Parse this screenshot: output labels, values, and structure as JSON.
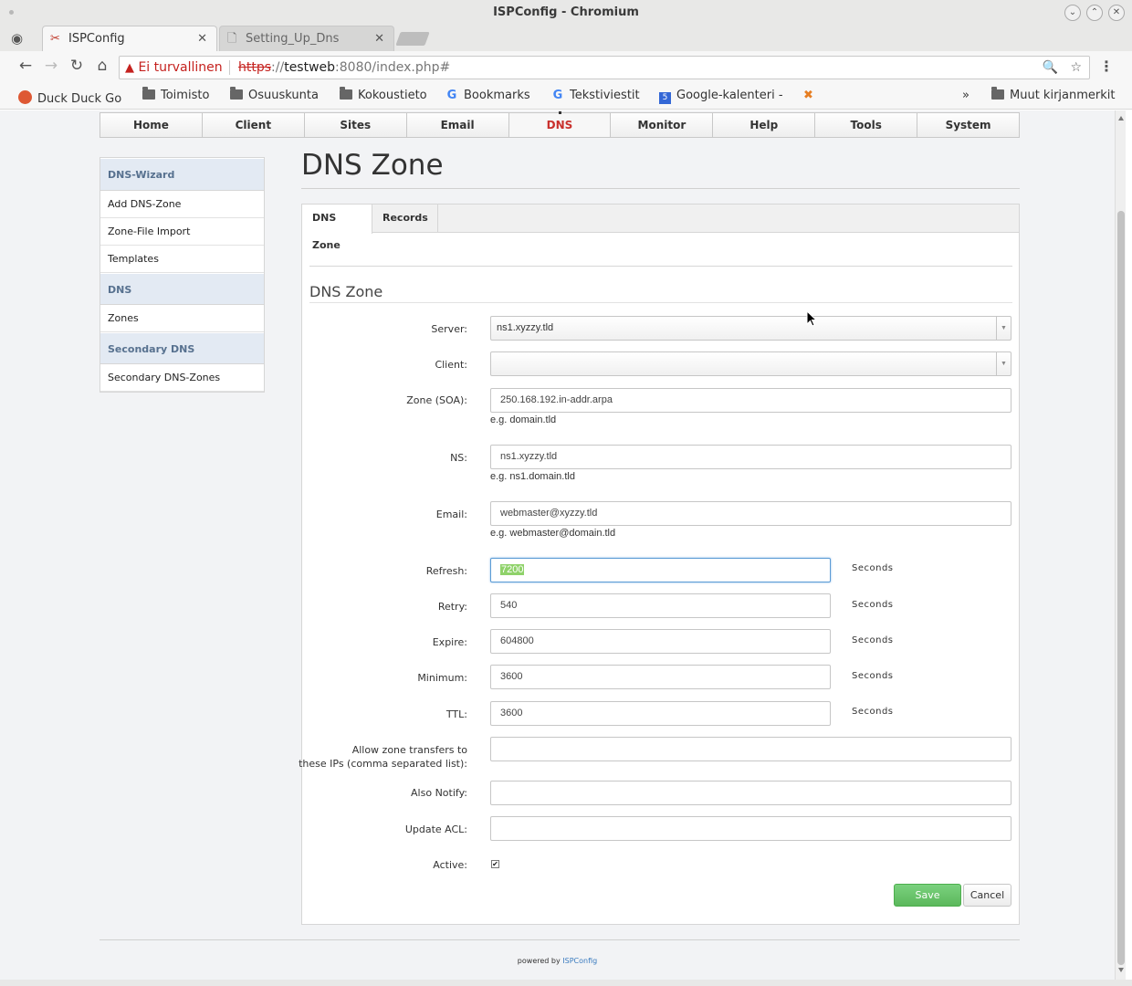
{
  "window": {
    "title": "ISPConfig - Chromium",
    "tabs": [
      {
        "label": "ISPConfig",
        "active": true
      },
      {
        "label": "Setting_Up_Dns",
        "active": false
      }
    ]
  },
  "omnibox": {
    "security_label": "Ei turvallinen",
    "url_protocol": "https",
    "url_sep": "://",
    "url_host": "testweb",
    "url_rest": ":8080/index.php#"
  },
  "bookmarks": [
    {
      "label": "Duck Duck Go",
      "icon": "duckduckgo-icon"
    },
    {
      "label": "Toimisto",
      "icon": "folder-icon"
    },
    {
      "label": "Osuuskunta",
      "icon": "folder-icon"
    },
    {
      "label": "Kokoustieto",
      "icon": "folder-icon"
    },
    {
      "label": "Bookmarks",
      "icon": "google-icon"
    },
    {
      "label": "Tekstiviestit",
      "icon": "google-icon"
    },
    {
      "label": "Google-kalenteri -",
      "icon": "calendar-icon"
    },
    {
      "label": "",
      "icon": "x-icon"
    }
  ],
  "bookmarks_other": "Muut kirjanmerkit",
  "topnav": [
    "Home",
    "Client",
    "Sites",
    "Email",
    "DNS",
    "Monitor",
    "Help",
    "Tools",
    "System"
  ],
  "sidebar": {
    "sections": [
      {
        "heading": "DNS-Wizard",
        "items": [
          "Add DNS-Zone",
          "Zone-File Import",
          "Templates"
        ]
      },
      {
        "heading": "DNS",
        "items": [
          "Zones"
        ]
      },
      {
        "heading": "Secondary DNS",
        "items": [
          "Secondary DNS-Zones"
        ]
      }
    ]
  },
  "page": {
    "title": "DNS Zone",
    "tabs": [
      "DNS Zone",
      "Records"
    ],
    "legend": "DNS Zone"
  },
  "form": {
    "server": {
      "label": "Server:",
      "value": "ns1.xyzzy.tld"
    },
    "client": {
      "label": "Client:",
      "value": ""
    },
    "zone": {
      "label": "Zone (SOA):",
      "value": "250.168.192.in-addr.arpa",
      "hint": "e.g. domain.tld"
    },
    "ns": {
      "label": "NS:",
      "value": "ns1.xyzzy.tld",
      "hint": "e.g. ns1.domain.tld"
    },
    "email": {
      "label": "Email:",
      "value": "webmaster@xyzzy.tld",
      "hint": "e.g. webmaster@domain.tld"
    },
    "refresh": {
      "label": "Refresh:",
      "value": "7200",
      "unit": "Seconds"
    },
    "retry": {
      "label": "Retry:",
      "value": "540",
      "unit": "Seconds"
    },
    "expire": {
      "label": "Expire:",
      "value": "604800",
      "unit": "Seconds"
    },
    "minimum": {
      "label": "Minimum:",
      "value": "3600",
      "unit": "Seconds"
    },
    "ttl": {
      "label": "TTL:",
      "value": "3600",
      "unit": "Seconds"
    },
    "xfer": {
      "label_line1": "Allow zone transfers to",
      "label_line2": "these IPs (comma separated list):",
      "value": ""
    },
    "also_notify": {
      "label": "Also Notify:",
      "value": ""
    },
    "update_acl": {
      "label": "Update ACL:",
      "value": ""
    },
    "active": {
      "label": "Active:",
      "checked": true
    },
    "save_label": "Save",
    "cancel_label": "Cancel"
  },
  "footer": {
    "prefix": "powered by",
    "brand": "ISPConfig"
  }
}
